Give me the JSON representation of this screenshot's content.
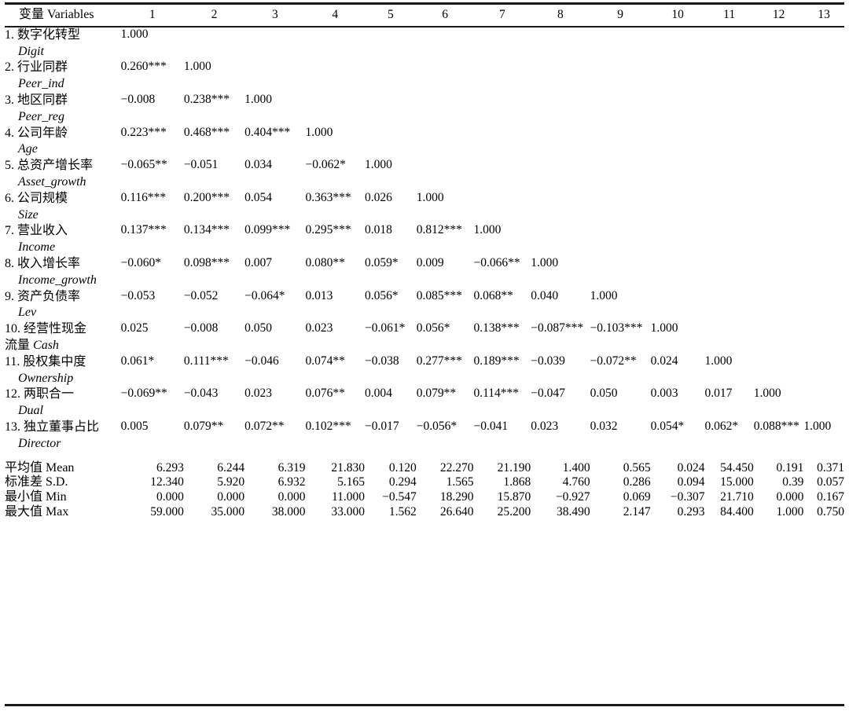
{
  "table": {
    "header": {
      "variables_label": "变量 Variables",
      "columns": [
        "1",
        "2",
        "3",
        "4",
        "5",
        "6",
        "7",
        "8",
        "9",
        "10",
        "11",
        "12",
        "13"
      ]
    },
    "rows": [
      {
        "index": "1.",
        "name_cn": "1. 数字化转型",
        "name_en": "Digit",
        "wrap_cn": "",
        "values": [
          "1.000",
          "",
          "",
          "",
          "",
          "",
          "",
          "",
          "",
          "",
          "",
          "",
          ""
        ]
      },
      {
        "index": "2.",
        "name_cn": "2. 行业同群",
        "name_en": "Peer_ind",
        "wrap_cn": "",
        "values": [
          "0.260***",
          "1.000",
          "",
          "",
          "",
          "",
          "",
          "",
          "",
          "",
          "",
          "",
          ""
        ]
      },
      {
        "index": "3.",
        "name_cn": "3. 地区同群",
        "name_en": "Peer_reg",
        "wrap_cn": "",
        "values": [
          "−0.008",
          "0.238***",
          "1.000",
          "",
          "",
          "",
          "",
          "",
          "",
          "",
          "",
          "",
          ""
        ]
      },
      {
        "index": "4.",
        "name_cn": "4. 公司年龄",
        "name_en": "Age",
        "wrap_cn": "",
        "values": [
          "0.223***",
          "0.468***",
          "0.404***",
          "1.000",
          "",
          "",
          "",
          "",
          "",
          "",
          "",
          "",
          ""
        ]
      },
      {
        "index": "5.",
        "name_cn": "5. 总资产增长率",
        "name_en": "Asset_growth",
        "wrap_cn": "",
        "values": [
          "−0.065**",
          "−0.051",
          "0.034",
          "−0.062*",
          "1.000",
          "",
          "",
          "",
          "",
          "",
          "",
          "",
          ""
        ]
      },
      {
        "index": "6.",
        "name_cn": "6. 公司规模",
        "name_en": "Size",
        "wrap_cn": "",
        "values": [
          "0.116***",
          "0.200***",
          "0.054",
          "0.363***",
          "0.026",
          "1.000",
          "",
          "",
          "",
          "",
          "",
          "",
          ""
        ]
      },
      {
        "index": "7.",
        "name_cn": "7. 营业收入",
        "name_en": "Income",
        "wrap_cn": "",
        "values": [
          "0.137***",
          "0.134***",
          "0.099***",
          "0.295***",
          "0.018",
          "0.812***",
          "1.000",
          "",
          "",
          "",
          "",
          "",
          ""
        ]
      },
      {
        "index": "8.",
        "name_cn": "8. 收入增长率",
        "name_en": "Income_growth",
        "wrap_cn": "",
        "values": [
          "−0.060*",
          "0.098***",
          "0.007",
          "0.080**",
          "0.059*",
          "0.009",
          "−0.066**",
          "1.000",
          "",
          "",
          "",
          "",
          ""
        ]
      },
      {
        "index": "9.",
        "name_cn": "9. 资产负债率",
        "name_en": "Lev",
        "wrap_cn": "",
        "values": [
          "−0.053",
          "−0.052",
          "−0.064*",
          "0.013",
          "0.056*",
          "0.085***",
          "0.068**",
          "0.040",
          "1.000",
          "",
          "",
          "",
          ""
        ]
      },
      {
        "index": "10.",
        "name_cn": "10. 经营性现金",
        "name_en": "",
        "wrap_cn": "流量 Cash",
        "values": [
          "0.025",
          "−0.008",
          "0.050",
          "0.023",
          "−0.061*",
          "0.056*",
          "0.138***",
          "−0.087***",
          "−0.103***",
          "1.000",
          "",
          "",
          ""
        ]
      },
      {
        "index": "11.",
        "name_cn": "11. 股权集中度",
        "name_en": "Ownership",
        "wrap_cn": "",
        "values": [
          "0.061*",
          "0.111***",
          "−0.046",
          "0.074**",
          "−0.038",
          "0.277***",
          "0.189***",
          "−0.039",
          "−0.072**",
          "0.024",
          "1.000",
          "",
          ""
        ]
      },
      {
        "index": "12.",
        "name_cn": "12. 两职合一",
        "name_en": "Dual",
        "wrap_cn": "",
        "values": [
          "−0.069**",
          "−0.043",
          "0.023",
          "0.076**",
          "0.004",
          "0.079**",
          "0.114***",
          "−0.047",
          "0.050",
          "0.003",
          "0.017",
          "1.000",
          ""
        ]
      },
      {
        "index": "13.",
        "name_cn": "13. 独立董事占比",
        "name_en": "Director",
        "wrap_cn": "",
        "values": [
          "0.005",
          "0.079**",
          "0.072**",
          "0.102***",
          "−0.017",
          "−0.056*",
          "−0.041",
          "0.023",
          "0.032",
          "0.054*",
          "0.062*",
          "0.088***",
          "1.000"
        ]
      }
    ],
    "summary": [
      {
        "label": "平均值 Mean",
        "values": [
          "6.293",
          "6.244",
          "6.319",
          "21.830",
          "0.120",
          "22.270",
          "21.190",
          "1.400",
          "0.565",
          "0.024",
          "54.450",
          "0.191",
          "0.371"
        ]
      },
      {
        "label": "标准差 S.D.",
        "values": [
          "12.340",
          "5.920",
          "6.932",
          "5.165",
          "0.294",
          "1.565",
          "1.868",
          "4.760",
          "0.286",
          "0.094",
          "15.000",
          "0.39",
          "0.057"
        ]
      },
      {
        "label": "最小值 Min",
        "values": [
          "0.000",
          "0.000",
          "0.000",
          "11.000",
          "−0.547",
          "18.290",
          "15.870",
          "−0.927",
          "0.069",
          "−0.307",
          "21.710",
          "0.000",
          "0.167"
        ]
      },
      {
        "label": "最大值 Max",
        "values": [
          "59.000",
          "35.000",
          "38.000",
          "33.000",
          "1.562",
          "26.640",
          "25.200",
          "38.490",
          "2.147",
          "0.293",
          "84.400",
          "1.000",
          "0.750"
        ]
      }
    ]
  },
  "style": {
    "text_color": "#000000",
    "rule_color": "#1a1a1a",
    "background": "#ffffff"
  }
}
